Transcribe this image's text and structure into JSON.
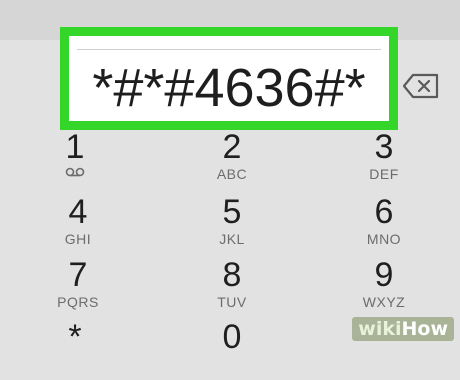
{
  "dialer": {
    "number": "*#*#4636#*",
    "backspace_icon": "backspace-icon"
  },
  "keypad": {
    "keys": [
      {
        "digit": "1",
        "letters": "",
        "icon": "voicemail-icon"
      },
      {
        "digit": "2",
        "letters": "ABC"
      },
      {
        "digit": "3",
        "letters": "DEF"
      },
      {
        "digit": "4",
        "letters": "GHI"
      },
      {
        "digit": "5",
        "letters": "JKL"
      },
      {
        "digit": "6",
        "letters": "MNO"
      },
      {
        "digit": "7",
        "letters": "PQRS"
      },
      {
        "digit": "8",
        "letters": "TUV"
      },
      {
        "digit": "9",
        "letters": "WXYZ"
      },
      {
        "digit": "*",
        "letters": ""
      },
      {
        "digit": "0",
        "letters": ""
      }
    ]
  },
  "colors": {
    "highlight": "#35d62a",
    "background": "#e2e2e2"
  },
  "watermark": {
    "wiki": "wiki",
    "how": "How"
  }
}
